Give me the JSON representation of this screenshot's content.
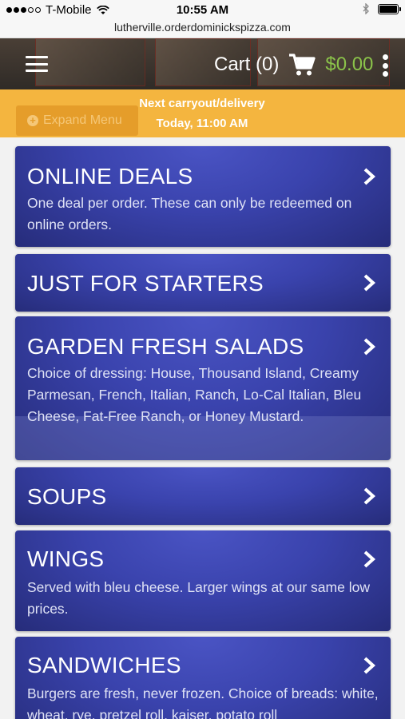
{
  "status_bar": {
    "carrier": "T-Mobile",
    "time": "10:55 AM"
  },
  "url_bar": {
    "url": "lutherville.orderdominickspizza.com"
  },
  "header": {
    "cart_label": "Cart (0)",
    "cart_total": "$0.00",
    "accent_total_color": "#8bc34a"
  },
  "band": {
    "expand_label": "Expand Menu",
    "next_line1": "Next carryout/delivery",
    "next_line2": "Today, 11:00 AM"
  },
  "menu": [
    {
      "title": "ONLINE DEALS",
      "description": "One deal per order. These can only be redeemed on online orders."
    },
    {
      "title": "JUST FOR STARTERS",
      "description": ""
    },
    {
      "title": "GARDEN FRESH SALADS",
      "description": "Choice of dressing: House, Thousand Island, Creamy Parmesan, French, Italian, Ranch, Lo-Cal Italian, Bleu Cheese, Fat-Free Ranch, or Honey Mustard."
    },
    {
      "title": "SOUPS",
      "description": ""
    },
    {
      "title": "WINGS",
      "description": "Served with bleu cheese. Larger wings at our same low prices."
    },
    {
      "title": "SANDWICHES",
      "description": "Burgers are fresh, never frozen. Choice of breads: white, wheat, rye, pretzel roll, kaiser, potato roll"
    }
  ]
}
